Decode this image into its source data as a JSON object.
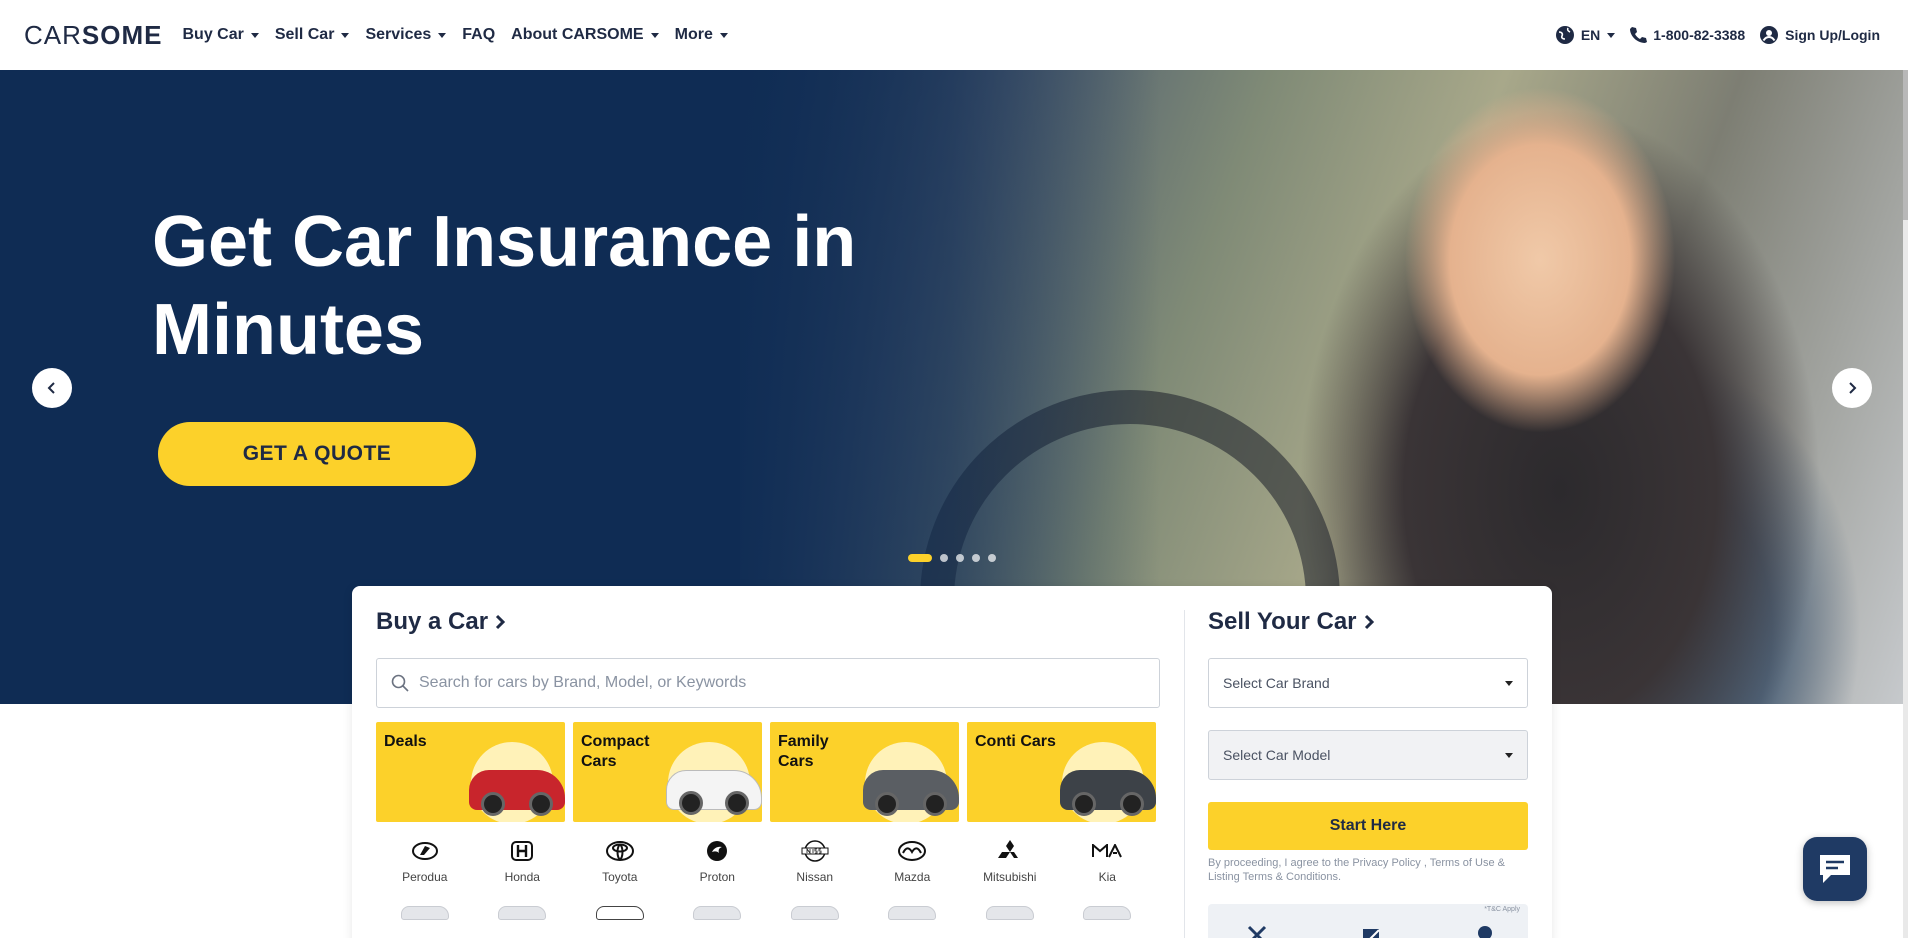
{
  "brand": {
    "logo_left": "CAR",
    "logo_right": "SOME"
  },
  "nav": {
    "items": [
      {
        "label": "Buy Car",
        "dropdown": true
      },
      {
        "label": "Sell Car",
        "dropdown": true
      },
      {
        "label": "Services",
        "dropdown": true
      },
      {
        "label": "FAQ",
        "dropdown": false
      },
      {
        "label": "About CARSOME",
        "dropdown": true
      },
      {
        "label": "More",
        "dropdown": true
      }
    ],
    "language": "EN",
    "phone": "1-800-82-3388",
    "login": "Sign Up/Login"
  },
  "hero": {
    "title": "Get Car Insurance in Minutes",
    "cta": "GET A QUOTE",
    "slides_total": 5,
    "active_slide": 1
  },
  "buy": {
    "title": "Buy a Car",
    "search_placeholder": "Search for cars by Brand, Model, or Keywords",
    "categories": [
      {
        "label": "Deals",
        "car_color": "#c8252c"
      },
      {
        "label": "Compact Cars",
        "car_color": "#f4f4f4"
      },
      {
        "label": "Family Cars",
        "car_color": "#5a5e63"
      },
      {
        "label": "Conti Cars",
        "car_color": "#3d4248"
      }
    ],
    "brands": [
      {
        "name": "Perodua",
        "icon": "perodua-icon"
      },
      {
        "name": "Honda",
        "icon": "honda-icon"
      },
      {
        "name": "Toyota",
        "icon": "toyota-icon"
      },
      {
        "name": "Proton",
        "icon": "proton-icon"
      },
      {
        "name": "Nissan",
        "icon": "nissan-icon"
      },
      {
        "name": "Mazda",
        "icon": "mazda-icon"
      },
      {
        "name": "Mitsubishi",
        "icon": "mitsubishi-icon"
      },
      {
        "name": "Kia",
        "icon": "kia-icon"
      }
    ]
  },
  "sell": {
    "title": "Sell Your Car",
    "brand_select": "Select Car Brand",
    "model_select": "Select Car Model",
    "start": "Start Here",
    "terms_prefix": "By proceeding, I agree to the",
    "privacy": "Privacy Policy",
    "terms_sep": ",",
    "terms_of_use": "Terms of Use & Listing Terms & Conditions",
    "terms_suffix": ".",
    "promo_tc": "*T&C Apply"
  },
  "colors": {
    "accent": "#fcd12a",
    "navy": "#0f2c54",
    "text": "#1f2a44"
  }
}
